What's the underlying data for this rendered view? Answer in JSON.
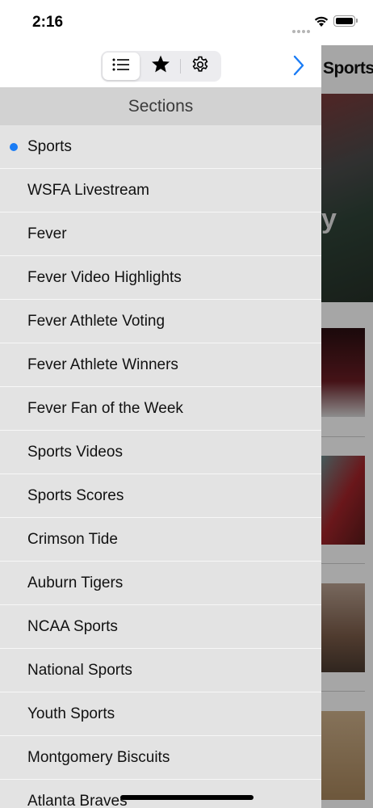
{
  "status": {
    "time": "2:16"
  },
  "toolbar": {
    "tabs": [
      {
        "icon": "list-icon",
        "active": true
      },
      {
        "icon": "star-icon",
        "active": false
      },
      {
        "icon": "gear-icon",
        "active": false
      }
    ],
    "forward_icon": "chevron-right-icon"
  },
  "background": {
    "page_title": "Sports",
    "hero_letter": "y"
  },
  "drawer": {
    "header": "Sections",
    "selected_color": "#1a7cf5",
    "items": [
      "Sports",
      "WSFA Livestream",
      "Fever",
      "Fever Video Highlights",
      "Fever Athlete Voting",
      "Fever Athlete Winners",
      "Fever Fan of the Week",
      "Sports Videos",
      "Sports Scores",
      "Crimson Tide",
      "Auburn Tigers",
      "NCAA Sports",
      "National Sports",
      "Youth Sports",
      "Montgomery Biscuits",
      "Atlanta Braves"
    ]
  }
}
